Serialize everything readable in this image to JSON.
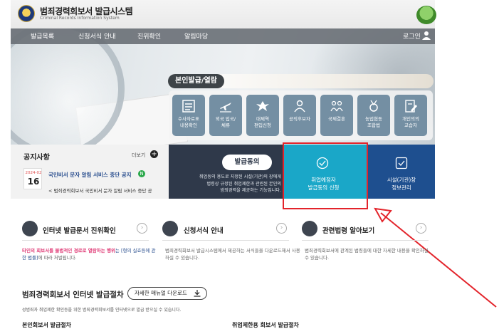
{
  "header": {
    "title": "범죄경력회보서 발급시스템",
    "subtitle": "Criminal Records Information System"
  },
  "nav": {
    "items": [
      "발급목록",
      "신청서식 안내",
      "진위확인",
      "알림마당"
    ],
    "login": "로그인"
  },
  "hero": {
    "issue_label": "본인발급/열람",
    "services": [
      {
        "label": "수사자료표\n내용확인",
        "icon": "document-list-icon"
      },
      {
        "label": "외국 입국/\n체류",
        "icon": "airplane-icon"
      },
      {
        "label": "대체역\n편입신청",
        "icon": "eagle-emblem-icon"
      },
      {
        "label": "공직후보자",
        "icon": "person-icon"
      },
      {
        "label": "국제결혼",
        "icon": "couple-icon"
      },
      {
        "label": "농업협동\n조합법",
        "icon": "medal-icon"
      },
      {
        "label": "개인의의\n교습자",
        "icon": "edit-document-icon"
      }
    ]
  },
  "notice": {
    "title": "공지사항",
    "more": "더보기",
    "date_ym": "2024-02",
    "date_day": "16",
    "item1": "국민비서 문자 알림 서비스 중단 공지",
    "new_badge": "N",
    "item2": "< 범죄경력회보서 국민비서 문자 알림 서비스 중단 공"
  },
  "consent": {
    "title": "발급동의",
    "desc": "취업동의 용도로 지정된 시설(기관)의 장에게\n법령상 규정된 취업제한과 관련된 본인의\n범죄경력을 제공하는 기능입니다."
  },
  "tiles": {
    "employee": "취업예정자\n발급동의 신청",
    "agency": "시설(기관)장\n정보관리"
  },
  "cards": [
    {
      "title": "인터넷 발급문서 진위확인",
      "icon": "document-check-icon",
      "desc_hl": "타인의 회보서를 불법적인 경로로 열람하는 행위",
      "desc_mid": "는 [형의 실효등에 관한 법률]",
      "desc_end": "에 따라 처벌됩니다."
    },
    {
      "title": "신청서식 안내",
      "icon": "document-icon",
      "desc": "범죄경력회보서 발급시스템에서 제공하는 서식들을 다운로드해서 사용하실 수 있습니다."
    },
    {
      "title": "관련법령 알아보기",
      "icon": "gavel-icon",
      "desc": "범죄경력회보서에 관계된 법령들에 대한 자세한 내용을 확인하실 수 있습니다."
    }
  ],
  "procedure": {
    "title": "범죄경력회보서 인터넷 발급절차",
    "manual_button": "자세한 매뉴얼 다운로드",
    "desc": "성범죄자 취업제한 확인등을 위한 범죄경력회보서를 인터넷으로 발급 받으실 수 있습니다.",
    "sub1": "본인회보서 발급절차",
    "sub2": "취업제한용 회보서 발급절차"
  },
  "colors": {
    "accent_teal": "#1aa7c8",
    "navy": "#1e4f8f",
    "dark_panel": "#2f394a",
    "highlight_red": "#e3242b"
  }
}
